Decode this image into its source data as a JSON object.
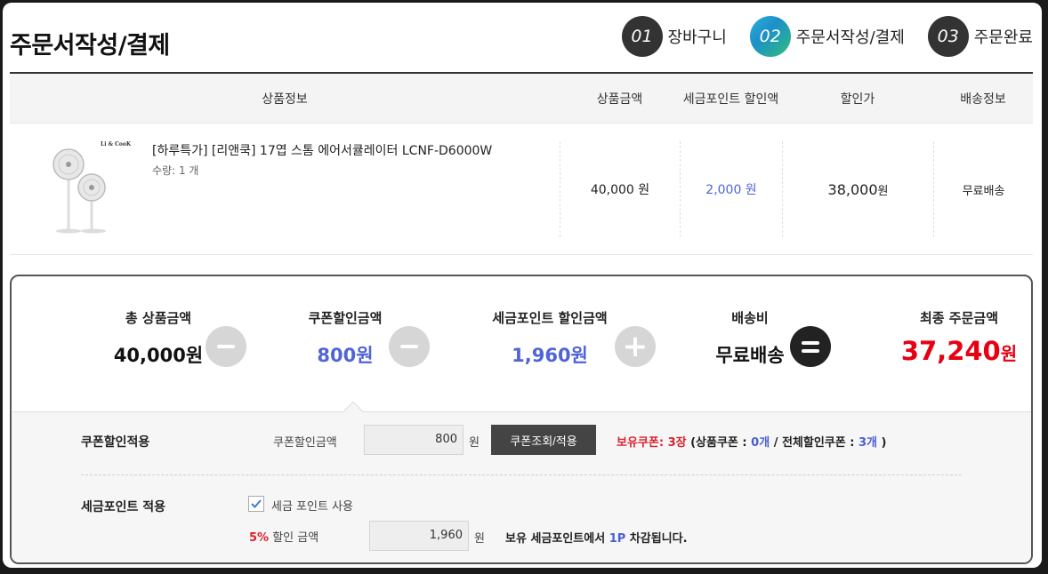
{
  "page": {
    "title": "주문서작성/결제"
  },
  "steps": [
    {
      "num": "01",
      "label": "장바구니"
    },
    {
      "num": "02",
      "label": "주문서작성/결제"
    },
    {
      "num": "03",
      "label": "주문완료"
    }
  ],
  "table": {
    "headers": {
      "product_info": "상품정보",
      "price": "상품금액",
      "point_discount": "세금포인트 할인액",
      "discount_price": "할인가",
      "shipping": "배송정보"
    },
    "row": {
      "image_brand": "Li & CooK",
      "name": "[하루특가] [리앤쿡] 17엽 스톰 에어서큘레이터 LCNF-D6000W",
      "qty": "수량: 1 개",
      "price": "40,000 원",
      "point_discount": "2,000 원",
      "discount_price": "38,000",
      "discount_unit": "원",
      "shipping": "무료배송"
    }
  },
  "summary": {
    "total": {
      "label": "총 상품금액",
      "value": "40,000원"
    },
    "coupon": {
      "label": "쿠폰할인금액",
      "value": "800원"
    },
    "points": {
      "label": "세금포인트 할인금액",
      "value": "1,960원"
    },
    "shipping": {
      "label": "배송비",
      "value": "무료배송"
    },
    "final": {
      "label": "최종 주문금액",
      "value": "37,240",
      "unit": "원"
    },
    "colors": {
      "blue": "#5064d8",
      "red": "#e60012"
    }
  },
  "coupon_section": {
    "title": "쿠폰할인적용",
    "field_label": "쿠폰할인금액",
    "value": "800",
    "unit": "원",
    "button": "쿠폰조회/적용",
    "owned_label": "보유쿠폰: 3장",
    "detail_open": "(상품쿠폰 : ",
    "product_count": "0개",
    "detail_mid": " / 전체할인쿠폰 : ",
    "total_count": "3개",
    "detail_close": " )"
  },
  "point_section": {
    "title": "세금포인트 적용",
    "checkbox_label": "세금 포인트 사용",
    "checked": true,
    "rate": "5%",
    "rate_label": "할인 금액",
    "value": "1,960",
    "unit": "원",
    "note_pre": "보유 세금포인트에서 ",
    "note_amount": "1P",
    "note_post": " 차감됩니다."
  }
}
